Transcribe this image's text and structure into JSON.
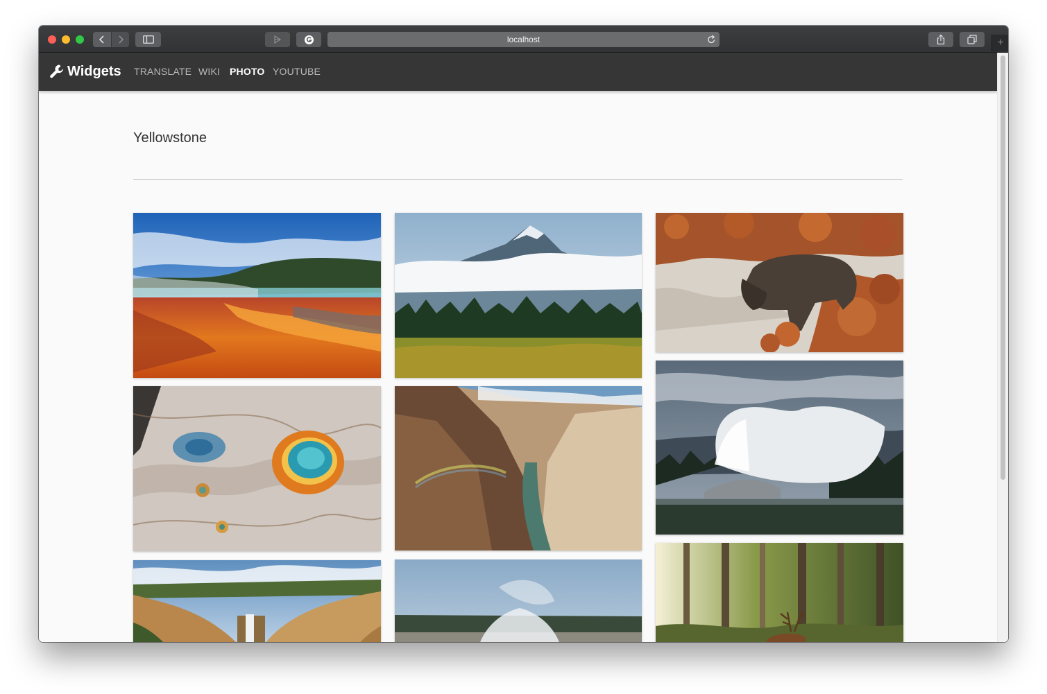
{
  "browser": {
    "url": "localhost"
  },
  "nav": {
    "brand": "Widgets",
    "links": [
      "TRANSLATE",
      "WIKI",
      "PHOTO",
      "YOUTUBE"
    ],
    "active": "PHOTO"
  },
  "page": {
    "title": "Yellowstone"
  },
  "photos": [
    "grand-prismatic-spring",
    "mountain-peak-in-clouds",
    "bison-in-autumn-brush",
    "aerial-hot-springs",
    "canyon-with-rainbow",
    "geyser-eruption",
    "canyon-waterfall",
    "steaming-geyser-basin",
    "elk-in-forest"
  ],
  "colors": {
    "appbar": "#363636",
    "page_background": "#fafafa",
    "active_nav": "#ffffff",
    "inactive_nav": "#b9b9b9"
  }
}
